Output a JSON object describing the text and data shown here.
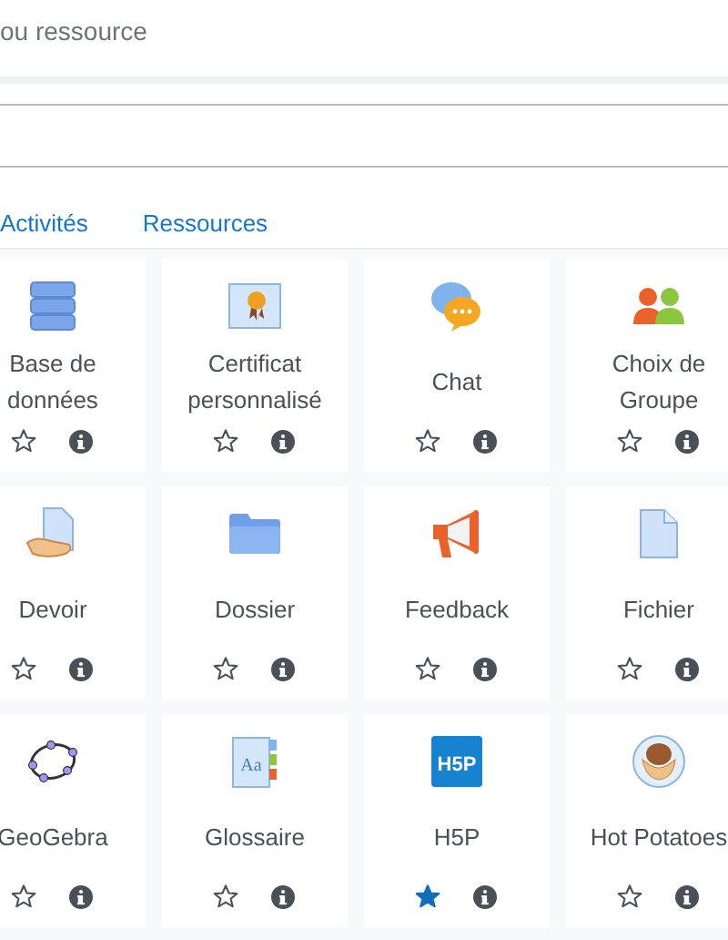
{
  "search": {
    "placeholder": "ou ressource"
  },
  "tabs": [
    {
      "label": "Activités",
      "selected": false
    },
    {
      "label": "Ressources",
      "selected": false
    }
  ],
  "modules": [
    {
      "name": "Base de données",
      "kind": "database",
      "starred": false
    },
    {
      "name": "Certificat personnalisé",
      "kind": "certificate",
      "starred": false
    },
    {
      "name": "Chat",
      "kind": "chat",
      "starred": false
    },
    {
      "name": "Choix de Groupe",
      "kind": "group",
      "starred": false
    },
    {
      "name": "Devoir",
      "kind": "assignment",
      "starred": false
    },
    {
      "name": "Dossier",
      "kind": "folder",
      "starred": false
    },
    {
      "name": "Feedback",
      "kind": "megaphone",
      "starred": false
    },
    {
      "name": "Fichier",
      "kind": "file",
      "starred": false
    },
    {
      "name": "GeoGebra",
      "kind": "geogebra",
      "starred": false
    },
    {
      "name": "Glossaire",
      "kind": "glossary",
      "starred": false,
      "logo_text": "Aa"
    },
    {
      "name": "H5P",
      "kind": "h5p",
      "starred": true,
      "logo_text": "H5P"
    },
    {
      "name": "Hot Potatoes",
      "kind": "potato",
      "starred": false
    }
  ]
}
